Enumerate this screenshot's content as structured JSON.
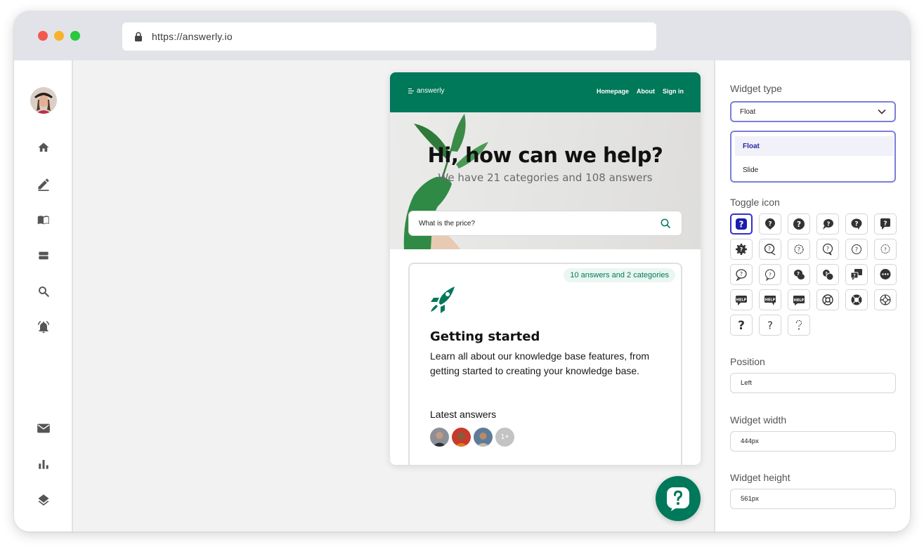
{
  "browser": {
    "url": "https://answerly.io"
  },
  "sidebar": {
    "items": [
      {
        "icon": "home-icon"
      },
      {
        "icon": "edit-icon"
      },
      {
        "icon": "book-icon"
      },
      {
        "icon": "storage-icon"
      },
      {
        "icon": "search-icon"
      },
      {
        "icon": "alarm-bell-icon"
      },
      {
        "icon": "mail-icon"
      },
      {
        "icon": "bar-chart-icon"
      },
      {
        "icon": "layers-icon"
      }
    ]
  },
  "widget": {
    "brand": "answerly",
    "nav": [
      "Homepage",
      "About",
      "Sign in"
    ],
    "hero_title": "Hi, how can we help?",
    "hero_subtitle": "We have 21 categories and 108 answers",
    "search_value": "What is the price?",
    "card": {
      "badge": "10 answers and 2 categories",
      "title": "Getting started",
      "description": "Learn all about our knowledge base features, from getting started to creating your knowledge base.",
      "latest_label": "Latest answers",
      "more_count": "1+"
    },
    "accent_color": "#00785a"
  },
  "panel": {
    "widget_type_label": "Widget type",
    "widget_type_value": "Float",
    "widget_type_options": [
      "Float",
      "Slide"
    ],
    "toggle_icon_label": "Toggle icon",
    "position_label": "Position",
    "position_value": "Left",
    "width_label": "Widget width",
    "width_value": "444px",
    "height_label": "Widget height",
    "height_value": "561px",
    "selection_color": "#2f2fd0"
  }
}
